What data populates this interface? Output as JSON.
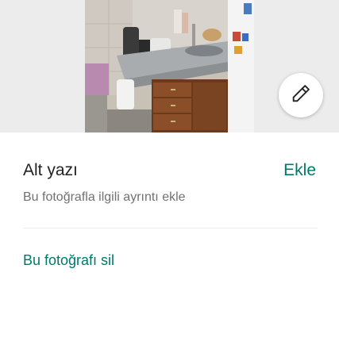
{
  "photo": {
    "description_icon": "kitchen-photo"
  },
  "edit": {
    "icon": "pencil-icon"
  },
  "caption": {
    "title": "Alt yazı",
    "add_label": "Ekle",
    "hint": "Bu fotoğrafla ilgili ayrıntı ekle"
  },
  "actions": {
    "delete_label": "Bu fotoğrafı sil"
  },
  "colors": {
    "accent": "#00796b",
    "text_primary": "#222222",
    "text_secondary": "#717171",
    "photo_background": "#ececec"
  }
}
